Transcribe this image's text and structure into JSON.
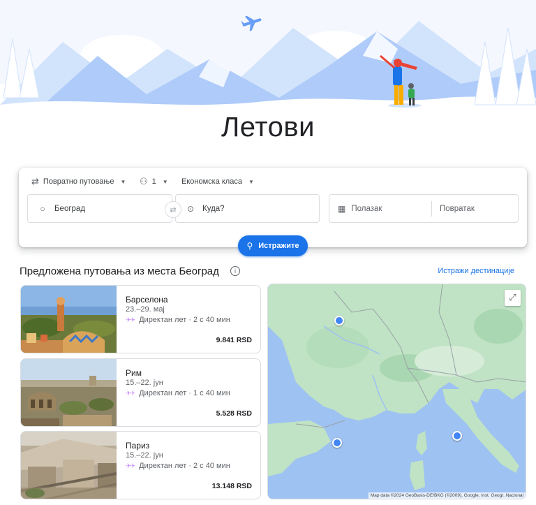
{
  "page": {
    "title": "Летови"
  },
  "search": {
    "trip_type": "Повратно путовање",
    "passengers": "1",
    "cabin_class": "Економска класа",
    "origin": "Београд",
    "destination_placeholder": "Куда?",
    "departure_placeholder": "Полазак",
    "return_placeholder": "Повратак",
    "search_button": "Истражите"
  },
  "suggestions": {
    "title": "Предложена путовања из места Београд",
    "explore_link": "Истражи дестинације",
    "cards": [
      {
        "city": "Барселона",
        "dates": "23.–29. мај",
        "route": "Директан лет · 2 с 40 мин",
        "price": "9.841 RSD"
      },
      {
        "city": "Рим",
        "dates": "15.–22. јун",
        "route": "Директан лет · 1 с 40 мин",
        "price": "5.528 RSD"
      },
      {
        "city": "Париз",
        "dates": "15.–22. јун",
        "route": "Директан лет · 2 с 40 мин",
        "price": "13.148 RSD"
      }
    ]
  },
  "map": {
    "attribution": "Map data ©2024 GeoBasis-DE/BKG (©2009), Google, Inst. Geogr. Nacional"
  },
  "colors": {
    "accent": "#1a73e8",
    "map_water": "#9ec2f2",
    "map_land": "#bfe3c4",
    "pin": "#4285f4"
  }
}
